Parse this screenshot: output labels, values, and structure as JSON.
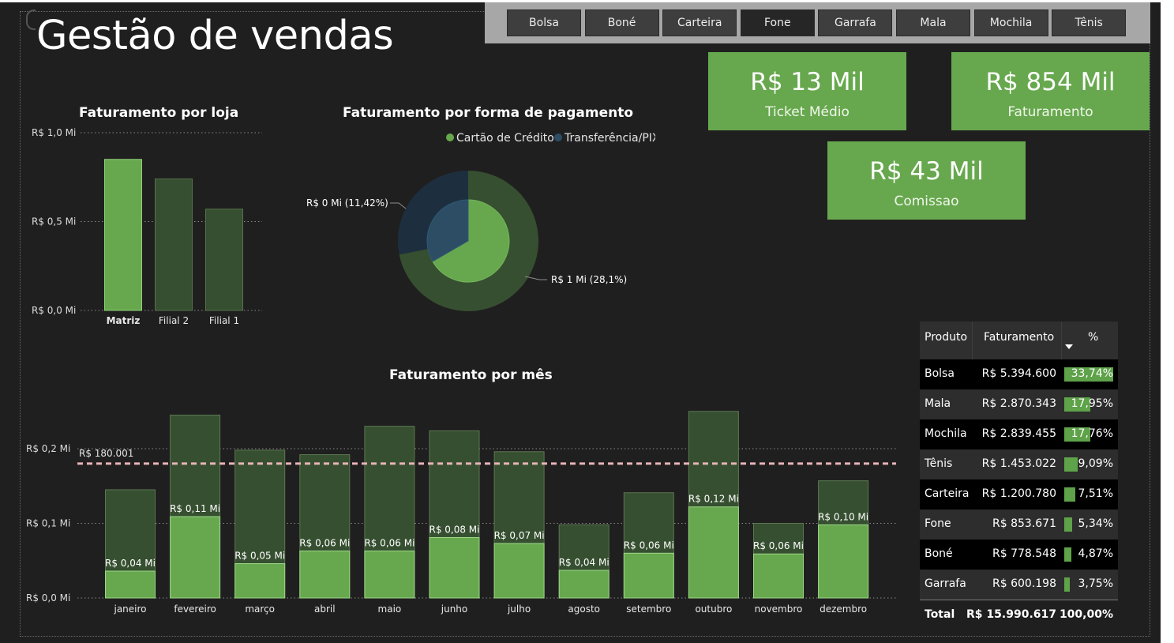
{
  "page": {
    "title": "Gestão de vendas"
  },
  "slicer": {
    "items": [
      "Bolsa",
      "Boné",
      "Carteira",
      "Fone",
      "Garrafa",
      "Mala",
      "Mochila",
      "Tênis"
    ],
    "selected": "Fone"
  },
  "kpis": {
    "ticket": {
      "value": "R$ 13 Mil",
      "label": "Ticket Médio"
    },
    "faturamento": {
      "value": "R$ 854 Mil",
      "label": "Faturamento"
    },
    "comissao": {
      "value": "R$ 43 Mil",
      "label": "Comissao"
    }
  },
  "colors": {
    "bright_green": "#67a84e",
    "dark_green": "#364f30",
    "navy": "#1d2f3f",
    "background": "#201f1f",
    "target_line": "#e8b4b8"
  },
  "chart_data": [
    {
      "type": "bar",
      "title": "Faturamento por loja",
      "categories": [
        "Matriz",
        "Filial 2",
        "Filial 1"
      ],
      "values": [
        0.85,
        0.74,
        0.57
      ],
      "yticks": [
        "R$ 0,0 Mi",
        "R$ 0,5 Mi",
        "R$ 1,0 Mi"
      ],
      "ylim": [
        0,
        1.0
      ],
      "highlighted": "Matriz",
      "grid": true
    },
    {
      "type": "pie",
      "title": "Faturamento por forma de pagamento",
      "legend": [
        "Cartão de Crédito",
        "Transferência/PIX"
      ],
      "legend_position": "top",
      "series": [
        {
          "name": "Cartão de Crédito",
          "share": 0.719
        },
        {
          "name": "Transferência/PIX",
          "share": 0.281
        }
      ],
      "highlight_share": [
        0.6667,
        0.3333
      ],
      "labels": [
        "R$ 0 Mi (11,42%)",
        "R$ 1 Mi (28,1%)"
      ]
    },
    {
      "type": "bar",
      "title": "Faturamento por mês",
      "categories": [
        "janeiro",
        "fevereiro",
        "março",
        "abril",
        "maio",
        "junho",
        "julho",
        "agosto",
        "setembro",
        "outubro",
        "novembro",
        "dezembro"
      ],
      "series": [
        {
          "values": [
            0.145,
            0.245,
            0.198,
            0.192,
            0.23,
            0.224,
            0.196,
            0.098,
            0.141,
            0.25,
            0.1,
            0.157
          ]
        },
        {
          "values": [
            0.036,
            0.109,
            0.046,
            0.063,
            0.063,
            0.081,
            0.073,
            0.037,
            0.06,
            0.122,
            0.059,
            0.098
          ]
        }
      ],
      "data_labels": [
        "R$ 0,04 Mi",
        "R$ 0,11 Mi",
        "R$ 0,05 Mi",
        "R$ 0,06 Mi",
        "R$ 0,06 Mi",
        "R$ 0,08 Mi",
        "R$ 0,07 Mi",
        "R$ 0,04 Mi",
        "R$ 0,06 Mi",
        "R$ 0,12 Mi",
        "R$ 0,06 Mi",
        "R$ 0,10 Mi"
      ],
      "target_value": 0.180001,
      "target_label": "R$ 180.001",
      "yticks": [
        "R$ 0,0 Mi",
        "R$ 0,1 Mi",
        "R$ 0,2 Mi"
      ],
      "ylim": [
        0,
        0.2
      ],
      "grid": true
    },
    {
      "type": "table",
      "columns": [
        "Produto",
        "Faturamento",
        "%"
      ],
      "sort_column": "%",
      "rows": [
        {
          "produto": "Bolsa",
          "faturamento": "R$ 5.394.600",
          "pct": "33,74%",
          "pct_value": 33.74
        },
        {
          "produto": "Mala",
          "faturamento": "R$ 2.870.343",
          "pct": "17,95%",
          "pct_value": 17.95
        },
        {
          "produto": "Mochila",
          "faturamento": "R$ 2.839.455",
          "pct": "17,76%",
          "pct_value": 17.76
        },
        {
          "produto": "Tênis",
          "faturamento": "R$ 1.453.022",
          "pct": "9,09%",
          "pct_value": 9.09
        },
        {
          "produto": "Carteira",
          "faturamento": "R$ 1.200.780",
          "pct": "7,51%",
          "pct_value": 7.51
        },
        {
          "produto": "Fone",
          "faturamento": "R$ 853.671",
          "pct": "5,34%",
          "pct_value": 5.34
        },
        {
          "produto": "Boné",
          "faturamento": "R$ 778.548",
          "pct": "4,87%",
          "pct_value": 4.87
        },
        {
          "produto": "Garrafa",
          "faturamento": "R$ 600.198",
          "pct": "3,75%",
          "pct_value": 3.75
        }
      ],
      "total": {
        "label": "Total",
        "faturamento": "R$ 15.990.617",
        "pct": "100,00%"
      }
    }
  ]
}
